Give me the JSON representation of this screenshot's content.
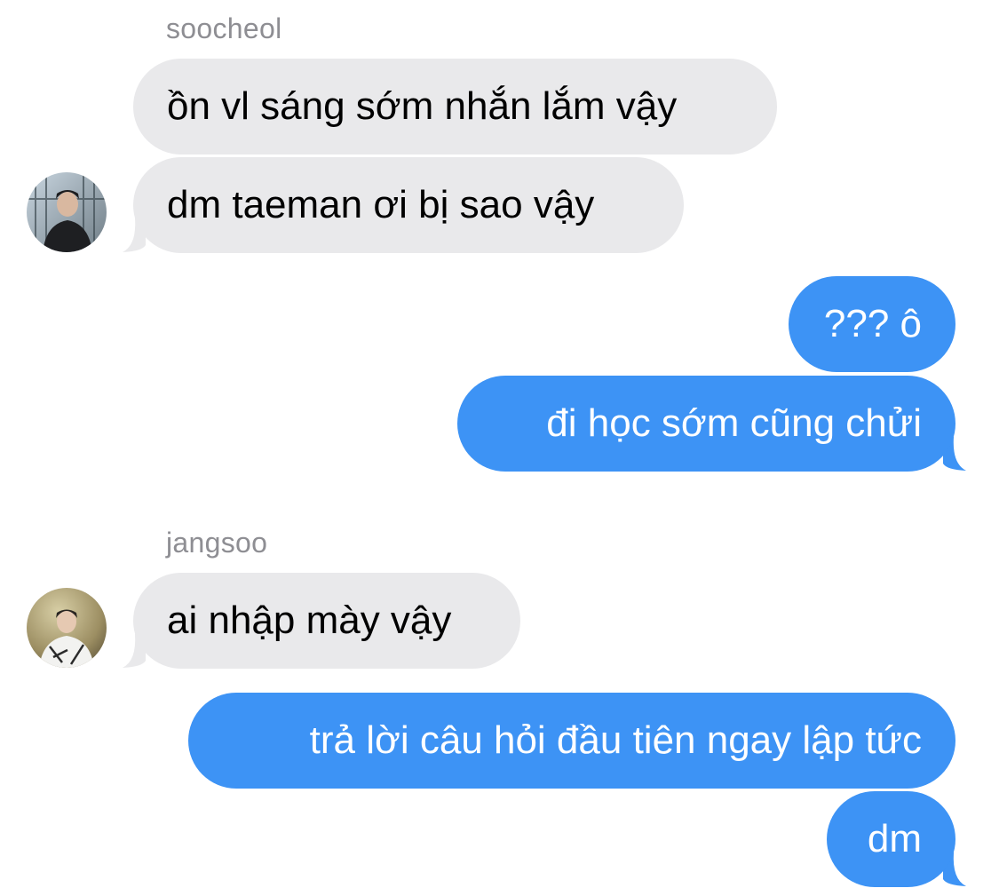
{
  "colors": {
    "incoming_bubble": "#e9e9eb",
    "outgoing_bubble": "#3d93f5",
    "sender_name": "#8e8e93"
  },
  "groups": [
    {
      "sender": "soocheol",
      "messages": [
        "ồn vl sáng sớm nhắn lắm vậy",
        "dm taeman ơi bị sao vậy"
      ]
    },
    {
      "outgoing": true,
      "messages": [
        "??? ô",
        "đi học sớm cũng chửi"
      ]
    },
    {
      "sender": "jangsoo",
      "messages": [
        "ai nhập mày vậy"
      ]
    },
    {
      "outgoing": true,
      "messages": [
        "trả lời câu hỏi đầu tiên ngay lập tức",
        "dm"
      ]
    }
  ]
}
